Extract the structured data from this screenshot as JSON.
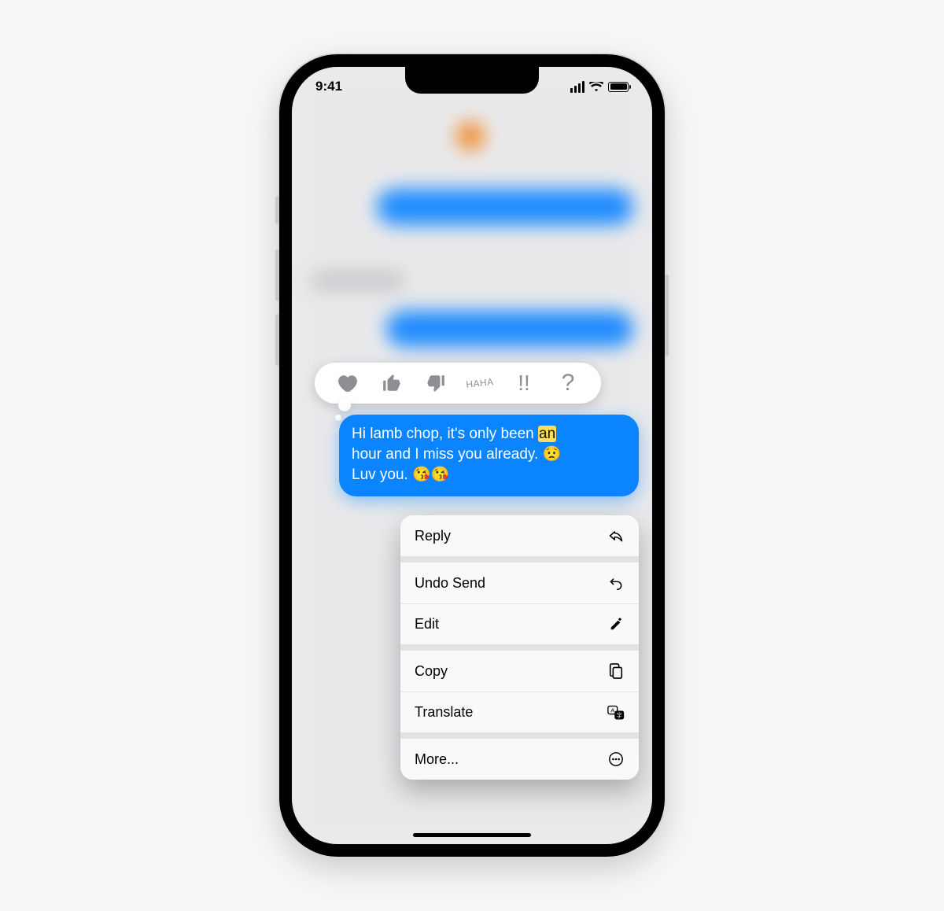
{
  "status": {
    "time": "9:41"
  },
  "tapback": {
    "heart": "heart",
    "thumbs_up": "thumbs-up",
    "thumbs_down": "thumbs-down",
    "haha_top": "HA",
    "haha_bottom": "HA",
    "bang": "!!",
    "question": "?"
  },
  "message": {
    "line1_a": "Hi lamb chop, it's only been ",
    "line1_b": "an",
    "line2": "hour and I miss you already. 😟",
    "line3": "Luv you. 😘😘"
  },
  "menu": {
    "reply": "Reply",
    "undo_send": "Undo Send",
    "edit": "Edit",
    "copy": "Copy",
    "translate": "Translate",
    "more": "More..."
  }
}
